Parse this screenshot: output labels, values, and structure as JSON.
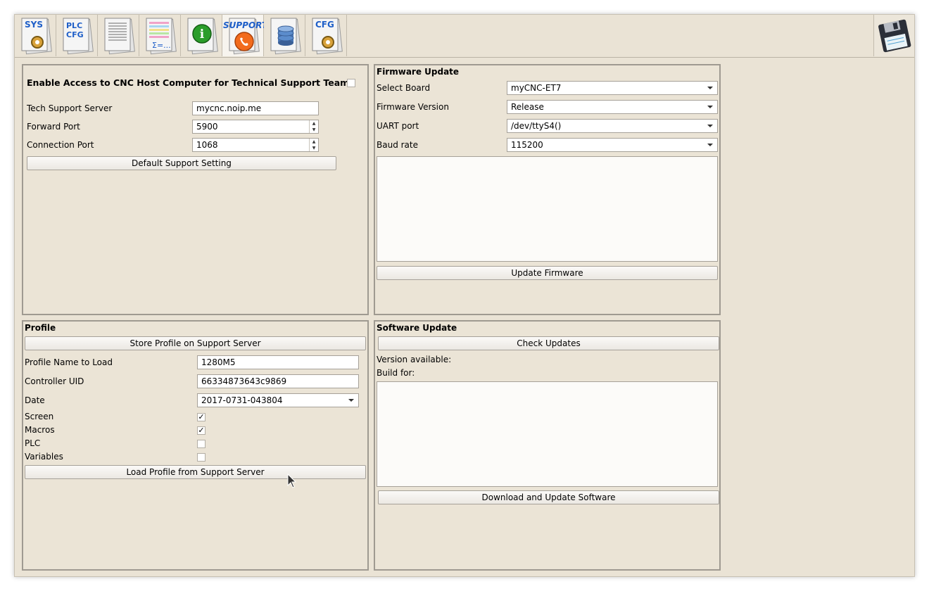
{
  "toolbar": {
    "tabs": [
      {
        "name": "sys",
        "label": "SYS",
        "icon": "gear-icon"
      },
      {
        "name": "plc-cfg",
        "label": "PLC CFG",
        "icon": "document-icon"
      },
      {
        "name": "log",
        "label": "",
        "icon": "text-document-icon"
      },
      {
        "name": "variables",
        "label": "Σ=...",
        "icon": "table-document-icon"
      },
      {
        "name": "info",
        "label": "",
        "icon": "info-icon"
      },
      {
        "name": "support",
        "label": "SUPPORT",
        "icon": "phone-icon",
        "active": true
      },
      {
        "name": "database",
        "label": "",
        "icon": "database-icon"
      },
      {
        "name": "cfg",
        "label": "CFG",
        "icon": "gear-icon"
      }
    ],
    "save_icon": "floppy-disk-icon"
  },
  "support": {
    "enable_label": "Enable Access to CNC Host Computer for Technical Support Team",
    "enable_checked": false,
    "server_label": "Tech Support Server",
    "server_value": "mycnc.noip.me",
    "forward_label": "Forward Port",
    "forward_value": "5900",
    "connection_label": "Connection Port",
    "connection_value": "1068",
    "default_button": "Default Support Setting"
  },
  "firmware": {
    "title": "Firmware Update",
    "board_label": "Select Board",
    "board_value": "myCNC-ET7",
    "version_label": "Firmware Version",
    "version_value": "Release",
    "uart_label": "UART port",
    "uart_value": "/dev/ttyS4()",
    "baud_label": "Baud rate",
    "baud_value": "115200",
    "update_button": "Update Firmware"
  },
  "profile": {
    "title": "Profile",
    "store_button": "Store Profile on Support Server",
    "name_label": "Profile Name to Load",
    "name_value": "1280M5",
    "uid_label": "Controller UID",
    "uid_value": "66334873643c9869",
    "date_label": "Date",
    "date_value": "2017-0731-043804",
    "screen_label": "Screen",
    "macros_label": "Macros",
    "plc_label": "PLC",
    "variables_label": "Variables",
    "check_mark": "✓",
    "load_button": "Load Profile from Support Server"
  },
  "software": {
    "title": "Software Update",
    "check_button": "Check Updates",
    "version_label": "Version available:",
    "build_label": "Build for:",
    "download_button": "Download and Update Software"
  },
  "colors": {
    "background": "#eae3d5",
    "panel_border": "#9f9a91",
    "support_orange": "#f26b1d",
    "info_green": "#2a9d2a",
    "tab_text_blue": "#1f5fc8"
  }
}
